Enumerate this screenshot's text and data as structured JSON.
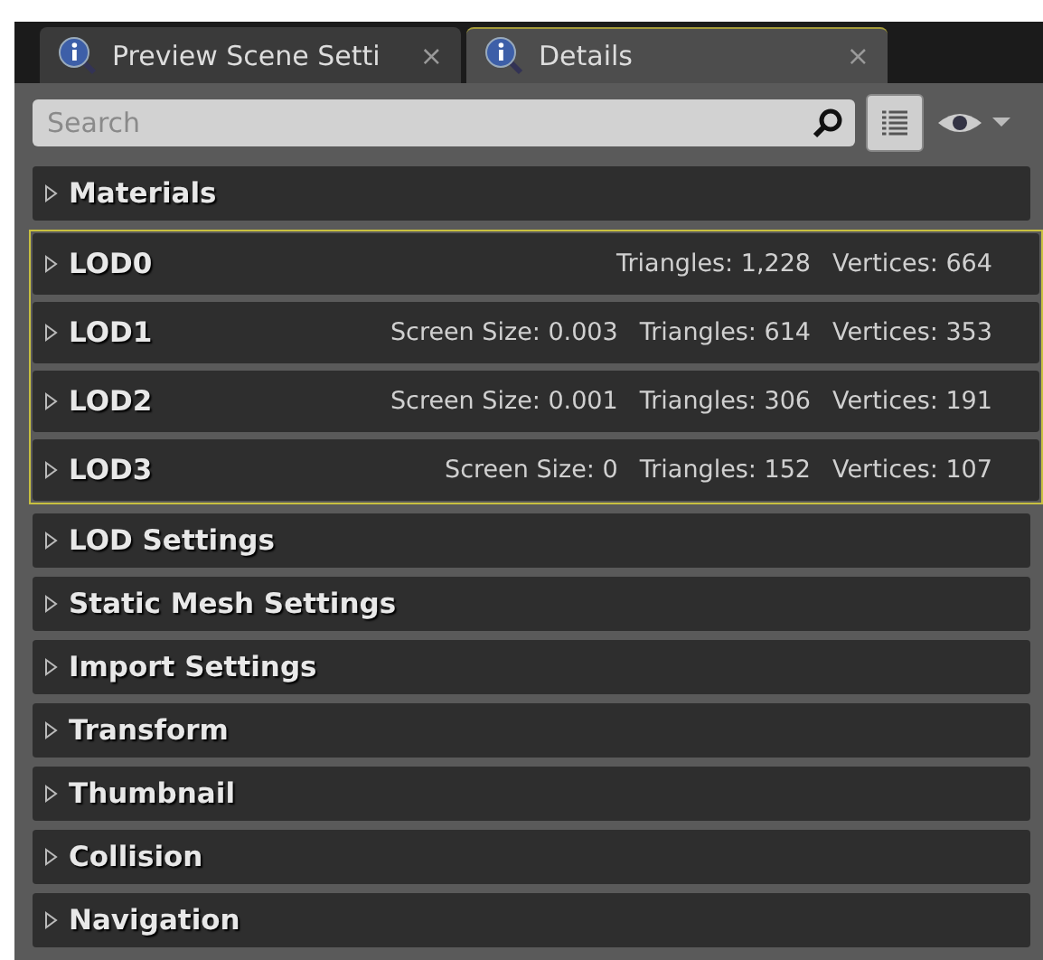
{
  "tabs": [
    {
      "label": "Preview Scene Setti",
      "close": "×",
      "selected": false
    },
    {
      "label": "Details",
      "close": "×",
      "selected": true
    }
  ],
  "search": {
    "placeholder": "Search"
  },
  "sections": [
    {
      "kind": "category",
      "label": "Materials",
      "expanded": false
    },
    {
      "kind": "lod_group",
      "highlighted": true,
      "rows": [
        {
          "label": "LOD0",
          "expanded": false,
          "stats": [
            "Triangles: 1,228",
            "Vertices: 664"
          ]
        },
        {
          "label": "LOD1",
          "expanded": false,
          "stats": [
            "Screen Size: 0.003",
            "Triangles: 614",
            "Vertices: 353"
          ]
        },
        {
          "label": "LOD2",
          "expanded": false,
          "stats": [
            "Screen Size: 0.001",
            "Triangles: 306",
            "Vertices: 191"
          ]
        },
        {
          "label": "LOD3",
          "expanded": false,
          "stats": [
            "Screen Size: 0",
            "Triangles: 152",
            "Vertices: 107"
          ]
        }
      ]
    },
    {
      "kind": "category",
      "label": "LOD Settings",
      "expanded": false
    },
    {
      "kind": "category",
      "label": "Static Mesh Settings",
      "expanded": false
    },
    {
      "kind": "category",
      "label": "Import Settings",
      "expanded": false
    },
    {
      "kind": "category",
      "label": "Transform",
      "expanded": false
    },
    {
      "kind": "category",
      "label": "Thumbnail",
      "expanded": false
    },
    {
      "kind": "category",
      "label": "Collision",
      "expanded": false
    },
    {
      "kind": "category",
      "label": "Navigation",
      "expanded": false
    }
  ]
}
